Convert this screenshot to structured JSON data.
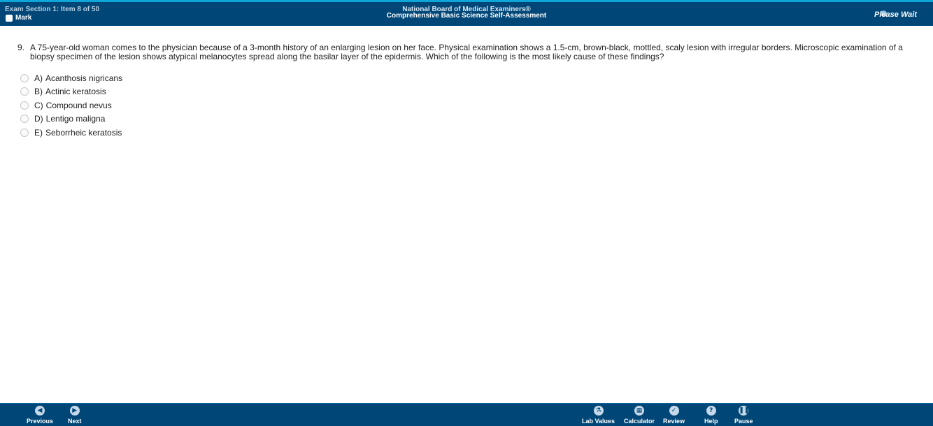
{
  "header": {
    "section_info": "Exam Section 1: Item 8 of 50",
    "mark_label": "Mark",
    "org": "National Board of Medical Examiners®",
    "exam_title": "Comprehensive Basic Science Self-Assessment",
    "status": "Please Wait"
  },
  "question": {
    "number": "9.",
    "text": "A 75-year-old woman comes to the physician because of a 3-month history of an enlarging lesion on her face. Physical examination shows a 1.5-cm, brown-black, mottled, scaly lesion with irregular borders. Microscopic examination of a biopsy specimen of the lesion shows atypical melanocytes spread along the basilar layer of the epidermis. Which of the following is the most likely cause of these findings?",
    "options": [
      {
        "letter": "A)",
        "text": "Acanthosis nigricans"
      },
      {
        "letter": "B)",
        "text": "Actinic keratosis"
      },
      {
        "letter": "C)",
        "text": "Compound nevus"
      },
      {
        "letter": "D)",
        "text": "Lentigo maligna"
      },
      {
        "letter": "E)",
        "text": "Seborrheic keratosis"
      }
    ]
  },
  "footer": {
    "previous": "Previous",
    "next": "Next",
    "lab_values": "Lab Values",
    "calculator": "Calculator",
    "review": "Review",
    "help": "Help",
    "pause": "Pause"
  },
  "icons": {
    "previous": "arrow-left-icon",
    "next": "arrow-right-icon",
    "lab_values": "flask-icon",
    "calculator": "calculator-icon",
    "review": "checkmark-icon",
    "help": "question-icon",
    "pause": "pause-icon"
  },
  "colors": {
    "header_bg": "#004778",
    "accent_top": "#0ea5d8"
  }
}
